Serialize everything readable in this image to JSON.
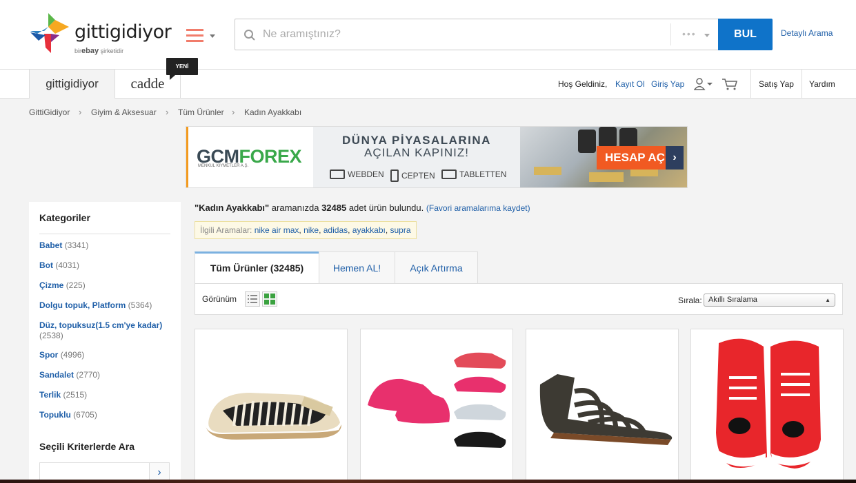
{
  "header": {
    "logo_text": "gittigidiyor",
    "logo_sub_prefix": "bir",
    "logo_sub_brand": "ebay",
    "logo_sub_suffix": "şirketidir",
    "search_placeholder": "Ne aramıştınız?",
    "search_category": "•••",
    "search_button": "BUL",
    "advanced_search": "Detaylı Arama"
  },
  "nav": {
    "tab_main": "gittigidiyor",
    "tab_cadde": "cadde",
    "new_badge": "YENİ",
    "welcome": "Hoş Geldiniz,",
    "signup": "Kayıt Ol",
    "login": "Giriş Yap",
    "sell": "Satış Yap",
    "help": "Yardım"
  },
  "breadcrumb": [
    "GittiGidiyor",
    "Giyim & Aksesuar",
    "Tüm Ürünler",
    "Kadın Ayakkabı"
  ],
  "banner": {
    "logo_a": "GCM",
    "logo_b": "FOREX",
    "logo_sub": "MENKUL KIYMETLER A.Ş.",
    "title1": "DÜNYA PİYASALARINA",
    "title2": "AÇILAN KAPINIZ!",
    "devices": [
      "WEBDEN",
      "CEPTEN",
      "TABLETTEN"
    ],
    "cta": "HESAP AÇ"
  },
  "sidebar": {
    "title": "Kategoriler",
    "categories": [
      {
        "name": "Babet",
        "count": "(3341)"
      },
      {
        "name": "Bot",
        "count": "(4031)"
      },
      {
        "name": "Çizme",
        "count": "(225)"
      },
      {
        "name": "Dolgu topuk, Platform",
        "count": "(5364)"
      },
      {
        "name": "Düz, topuksuz(1.5 cm'ye kadar)",
        "count": "(2538)"
      },
      {
        "name": "Spor",
        "count": "(4996)"
      },
      {
        "name": "Sandalet",
        "count": "(2770)"
      },
      {
        "name": "Terlik",
        "count": "(2515)"
      },
      {
        "name": "Topuklu",
        "count": "(6705)"
      }
    ],
    "criteria_title": "Seçili Kriterlerde Ara"
  },
  "results": {
    "query": "\"Kadın Ayakkabı\"",
    "mid_text": " aramanızda ",
    "count": "32485",
    "tail_text": " adet ürün bulundu.",
    "favorite": "(Favori aramalarıma kaydet)",
    "related_label": "İlgili Aramalar:",
    "related": [
      "nike air max",
      "nike",
      "adidas",
      "ayakkabı",
      "supra"
    ]
  },
  "tabs": [
    "Tüm Ürünler (32485)",
    "Hemen AL!",
    "Açık Artırma"
  ],
  "toolbar": {
    "view_label": "Görünüm",
    "sort_label": "Sırala:",
    "sort_value": "Akıllı Sıralama"
  },
  "colors": {
    "brand_blue": "#0f73c9",
    "link_blue": "#1f5fa8",
    "cta_orange": "#f15a22"
  }
}
